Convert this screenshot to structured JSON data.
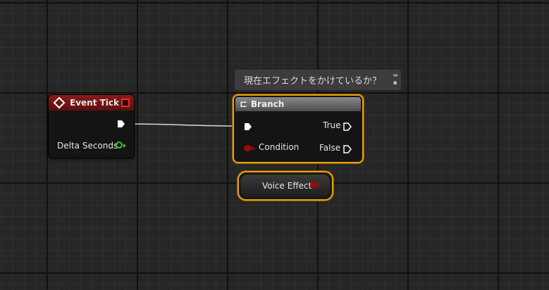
{
  "event_tick": {
    "title": "Event Tick",
    "delta_seconds_label": "Delta Seconds",
    "header_color": "#8a1a1a"
  },
  "comment": {
    "text": "現在エフェクトをかけているか？"
  },
  "branch": {
    "title": "Branch",
    "true_label": "True",
    "false_label": "False",
    "condition_label": "Condition",
    "header_color": "#6a6a6a",
    "selection_color": "#e6a010"
  },
  "voice_effect": {
    "label": "Voice Effect",
    "pin_color": "#9a0a0a"
  },
  "icons": {
    "event": "diamond-icon",
    "stop": "stop-icon",
    "branch": "branch-icon",
    "comment_pin": "pin-icon"
  }
}
